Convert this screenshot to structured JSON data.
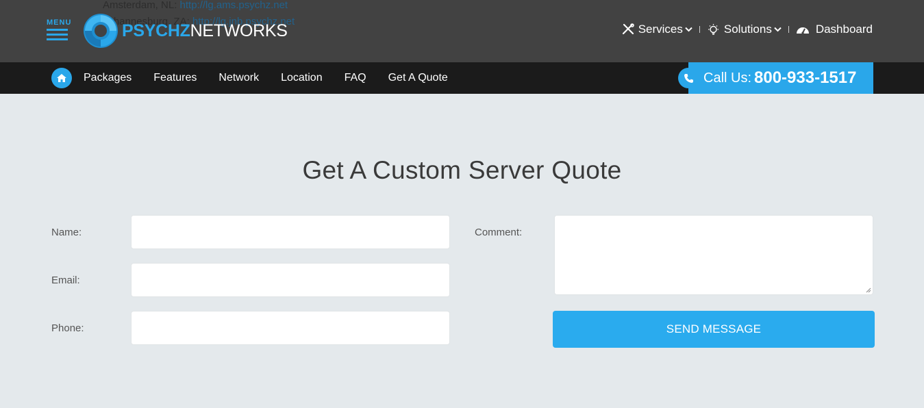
{
  "overlay": {
    "line1_prefix": "Amsterdam, NL: ",
    "line1_link": "http://lg.ams.psychz.net",
    "line2_prefix": "Johannesburg, ZA: ",
    "line2_link": "http://lg.jnb.psychz.net"
  },
  "header": {
    "menu_label": "MENU",
    "logo_part1": "PSYCHZ",
    "logo_part2": "NETWORKS",
    "nav": [
      {
        "label": "Services",
        "icon": "tools-icon"
      },
      {
        "label": "Solutions",
        "icon": "lightbulb-icon"
      },
      {
        "label": "Dashboard",
        "icon": "dashboard-icon"
      }
    ]
  },
  "navbar": {
    "links": [
      "Packages",
      "Features",
      "Network",
      "Location",
      "FAQ",
      "Get A Quote"
    ],
    "call_label": "Call Us:",
    "call_number": "800-933-1517"
  },
  "form": {
    "title": "Get A Custom Server Quote",
    "name_label": "Name:",
    "email_label": "Email:",
    "phone_label": "Phone:",
    "comment_label": "Comment:",
    "name_value": "",
    "email_value": "",
    "phone_value": "",
    "comment_value": "",
    "submit_label": "SEND MESSAGE"
  },
  "colors": {
    "accent": "#2aa7ea",
    "header_bg": "#424242",
    "navbar_bg": "#1b1b1b",
    "page_bg": "#e4e9ec"
  }
}
